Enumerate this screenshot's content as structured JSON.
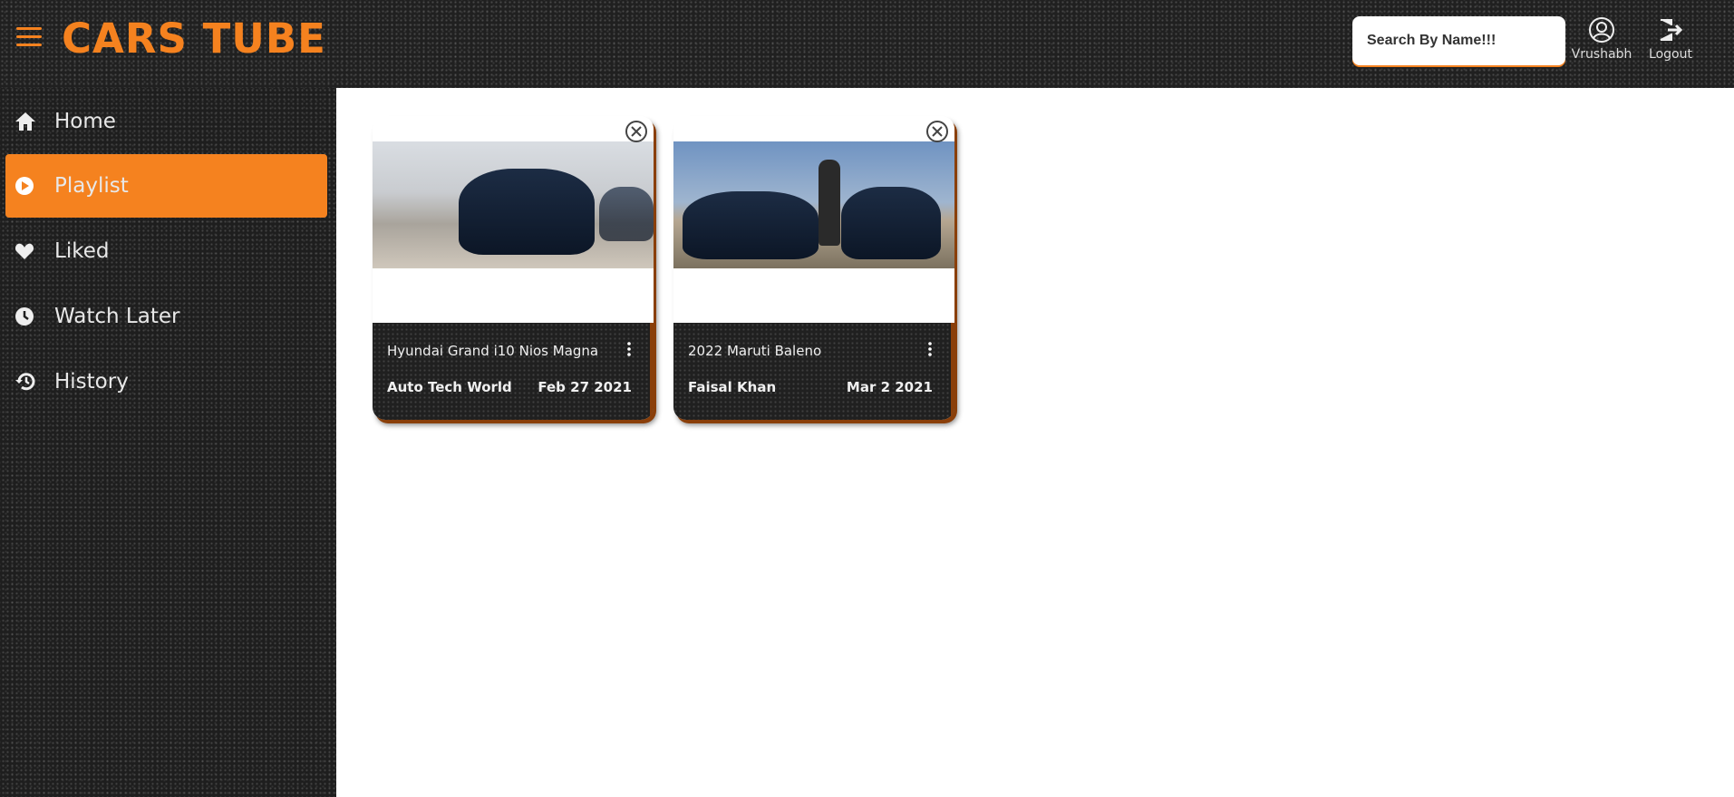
{
  "header": {
    "logo": "CARS TUBE",
    "search_placeholder": "Search By Name!!!",
    "user_label": "Vrushabh",
    "logout_label": "Logout"
  },
  "sidebar": {
    "items": [
      {
        "label": "Home",
        "icon": "home-icon",
        "active": false
      },
      {
        "label": "Playlist",
        "icon": "play-circle-icon",
        "active": true
      },
      {
        "label": "Liked",
        "icon": "heart-icon",
        "active": false
      },
      {
        "label": "Watch Later",
        "icon": "clock-icon",
        "active": false
      },
      {
        "label": "History",
        "icon": "history-icon",
        "active": false
      }
    ]
  },
  "videos": [
    {
      "title": "Hyundai Grand i10 Nios Magna",
      "channel": "Auto Tech World",
      "date": "Feb 27 2021"
    },
    {
      "title": "2022 Maruti Baleno",
      "channel": "Faisal Khan",
      "date": "Mar 2 2021"
    }
  ],
  "colors": {
    "accent": "#f5821f",
    "dark": "#202020"
  }
}
